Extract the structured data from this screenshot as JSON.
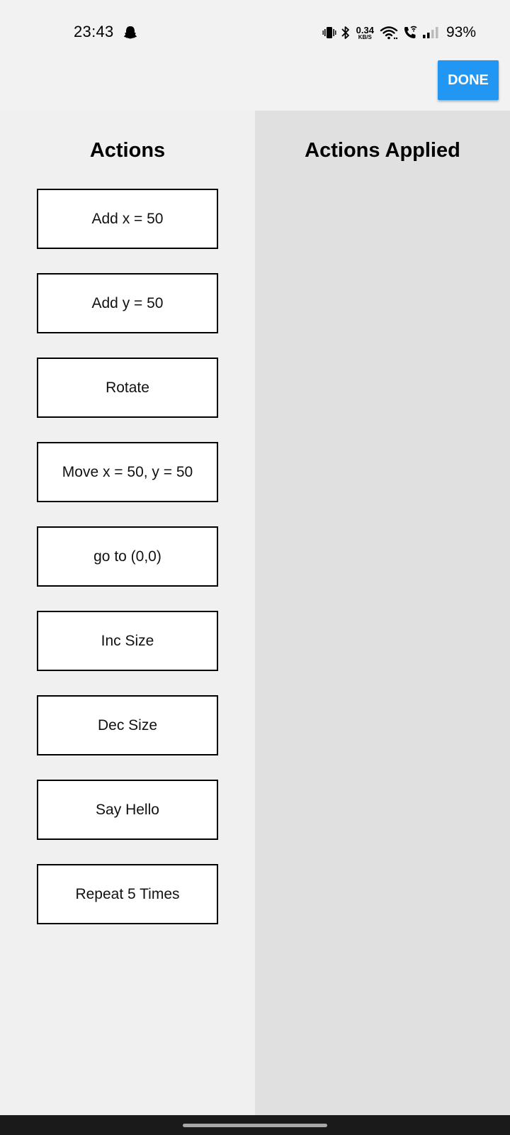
{
  "status_bar": {
    "time": "23:43",
    "left_icon": "snapchat-ghost-icon",
    "net_speed_value": "0.34",
    "net_speed_unit": "KB/S",
    "battery": "93%",
    "icons": [
      "vibrate-icon",
      "bluetooth-icon",
      "wifi-icon",
      "wifi-calling-icon",
      "signal-icon"
    ]
  },
  "top_bar": {
    "done_label": "DONE",
    "accent_color": "#2196f3"
  },
  "left_panel": {
    "title": "Actions",
    "items": [
      {
        "label": "Add x = 50"
      },
      {
        "label": "Add y = 50"
      },
      {
        "label": "Rotate"
      },
      {
        "label": "Move x = 50, y = 50"
      },
      {
        "label": "go to (0,0)"
      },
      {
        "label": "Inc Size"
      },
      {
        "label": "Dec Size"
      },
      {
        "label": "Say Hello"
      },
      {
        "label": "Repeat 5 Times"
      }
    ]
  },
  "right_panel": {
    "title": "Actions Applied",
    "items": []
  }
}
